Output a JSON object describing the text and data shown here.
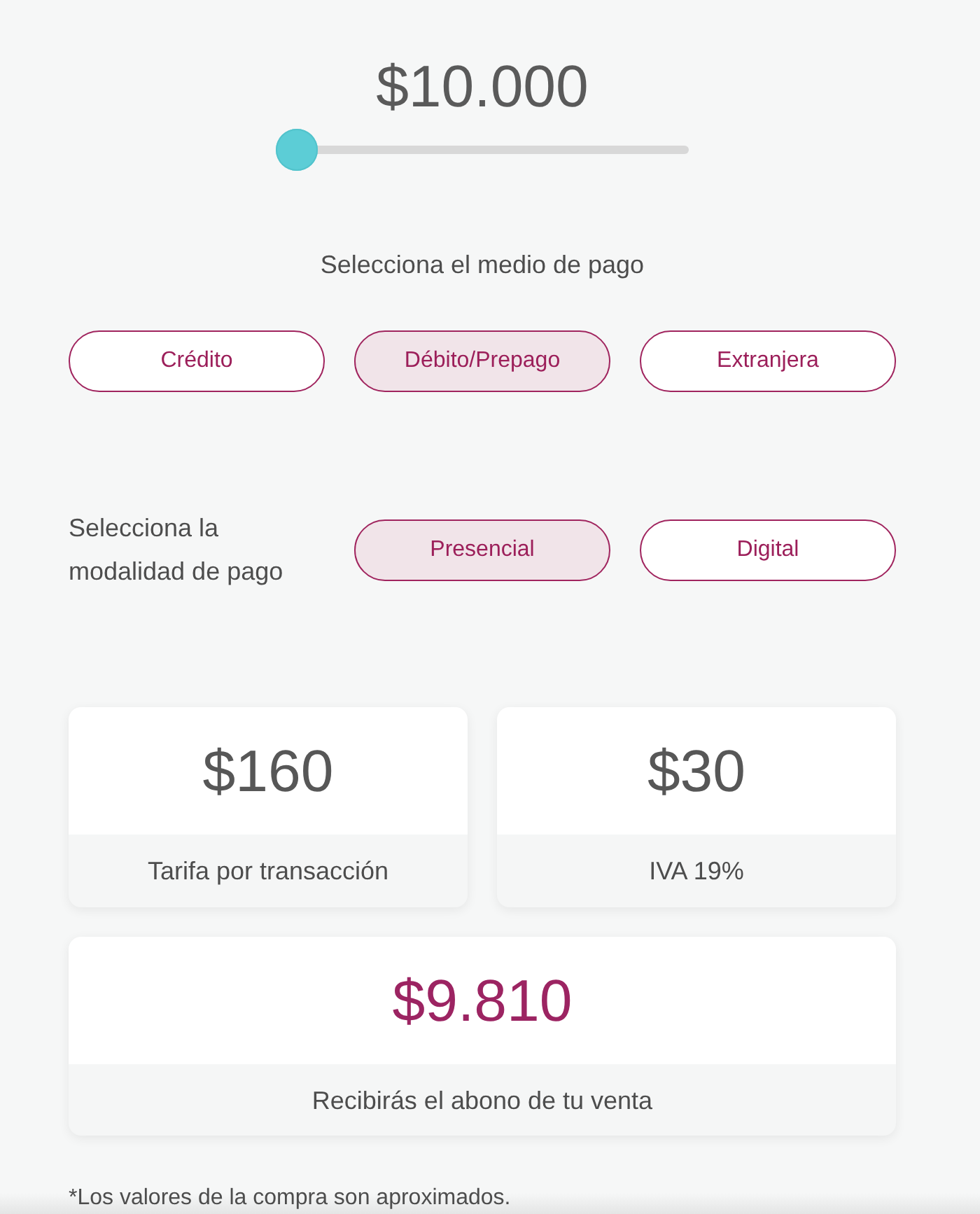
{
  "amount": {
    "value": "$10.000",
    "level": 0
  },
  "payment_method": {
    "label": "Selecciona el medio de pago",
    "options": [
      {
        "label": "Crédito",
        "selected": false
      },
      {
        "label": "Débito/Prepago",
        "selected": true
      },
      {
        "label": "Extranjera",
        "selected": false
      }
    ]
  },
  "payment_mode": {
    "label": "Selecciona la modalidad de pago",
    "options": [
      {
        "label": "Presencial",
        "selected": true
      },
      {
        "label": "Digital",
        "selected": false
      }
    ]
  },
  "summary": [
    {
      "kind": "fee",
      "value": "$160",
      "label": "Tarifa por transacción"
    },
    {
      "kind": "fee",
      "value": "$30",
      "label": "IVA 19%"
    },
    {
      "kind": "total",
      "value": "$9.810",
      "label": "Recibirás el abono de tu venta"
    }
  ],
  "footnote": "*Los valores de la compra son aproximados."
}
